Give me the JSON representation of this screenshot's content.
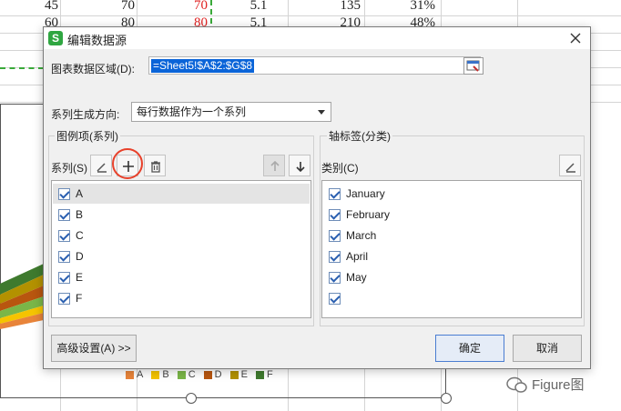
{
  "sheet": {
    "row1": [
      "45",
      "70",
      "70",
      "5.1",
      "135",
      "31%"
    ],
    "row2": [
      "60",
      "80",
      "80",
      "5.1",
      "210",
      "48%"
    ]
  },
  "legend": {
    "items": [
      {
        "label": "A",
        "color": "#e8843a"
      },
      {
        "label": "B",
        "color": "#f5c400"
      },
      {
        "label": "C",
        "color": "#7ab648"
      },
      {
        "label": "D",
        "color": "#b8560f"
      },
      {
        "label": "E",
        "color": "#b39100"
      },
      {
        "label": "F",
        "color": "#3f7a2e"
      }
    ]
  },
  "watermark": {
    "text": "Figure图"
  },
  "dialog": {
    "title": "编辑数据源",
    "app_icon_letter": "S",
    "range_label": "图表数据区域(D):",
    "range_value": "=Sheet5!$A$2:$G$8",
    "direction_label": "系列生成方向:",
    "direction_value": "每行数据作为一个系列",
    "legend_group": {
      "title": "图例项(系列)",
      "series_label": "系列(S)",
      "items": [
        {
          "label": "A",
          "checked": true,
          "selected": true
        },
        {
          "label": "B",
          "checked": true
        },
        {
          "label": "C",
          "checked": true
        },
        {
          "label": "D",
          "checked": true
        },
        {
          "label": "E",
          "checked": true
        },
        {
          "label": "F",
          "checked": true
        }
      ]
    },
    "axis_group": {
      "title": "轴标签(分类)",
      "category_label": "类别(C)",
      "items": [
        {
          "label": "January",
          "checked": true
        },
        {
          "label": "February",
          "checked": true
        },
        {
          "label": "March",
          "checked": true
        },
        {
          "label": "April",
          "checked": true
        },
        {
          "label": "May",
          "checked": true
        },
        {
          "label": "",
          "checked": true
        }
      ]
    },
    "advanced_button": "高级设置(A) >>",
    "ok_button": "确定",
    "cancel_button": "取消"
  }
}
